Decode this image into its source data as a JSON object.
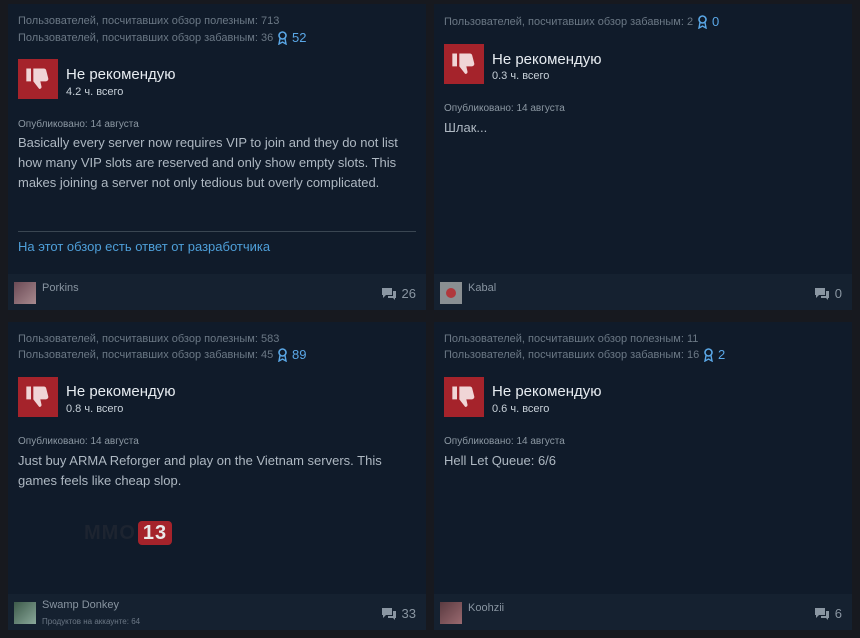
{
  "reviews": [
    {
      "helpful": "Пользователей, посчитавших обзор полезным: 713",
      "funny": "Пользователей, посчитавших обзор забавным: 36",
      "awards": "52",
      "verdict": "Не рекомендую",
      "hours": "4.2 ч. всего",
      "posted": "Опубликовано: 14 августа",
      "text": "Basically every server now requires VIP to join and they do not list how many VIP slots are reserved and only show empty slots. This makes joining a server not only tedious but overly complicated.",
      "dev_response": "На этот обзор есть ответ от разработчика",
      "author": "Porkins",
      "comments": "26"
    },
    {
      "funny": "Пользователей, посчитавших обзор забавным: 2",
      "awards": "0",
      "verdict": "Не рекомендую",
      "hours": "0.3 ч. всего",
      "posted": "Опубликовано: 14 августа",
      "text": "Шлак...",
      "author": "Kabal",
      "comments": "0"
    },
    {
      "helpful": "Пользователей, посчитавших обзор полезным: 583",
      "funny": "Пользователей, посчитавших обзор забавным: 45",
      "awards": "89",
      "verdict": "Не рекомендую",
      "hours": "0.8 ч. всего",
      "posted": "Опубликовано: 14 августа",
      "text": "Just buy ARMA Reforger and play on the Vietnam servers. This games feels like cheap slop.",
      "author": "Swamp Donkey",
      "author_sub": "Продуктов на аккаунте: 64",
      "comments": "33"
    },
    {
      "helpful": "Пользователей, посчитавших обзор полезным: 11",
      "funny": "Пользователей, посчитавших обзор забавным: 16",
      "awards": "2",
      "verdict": "Не рекомендую",
      "hours": "0.6 ч. всего",
      "posted": "Опубликовано: 14 августа",
      "text": "Hell Let Queue: 6/6",
      "author": "Koohzii",
      "comments": "6"
    }
  ],
  "watermark": {
    "letters": "MMO",
    "number": "13"
  },
  "icons": {
    "thumb": "thumbs-down-icon",
    "award": "award-ribbon-icon",
    "comment": "comment-bubble-icon"
  },
  "colors": {
    "thumb_bg": "#a5232b",
    "link": "#4e9fd9",
    "card_bg": "#101b2a"
  }
}
